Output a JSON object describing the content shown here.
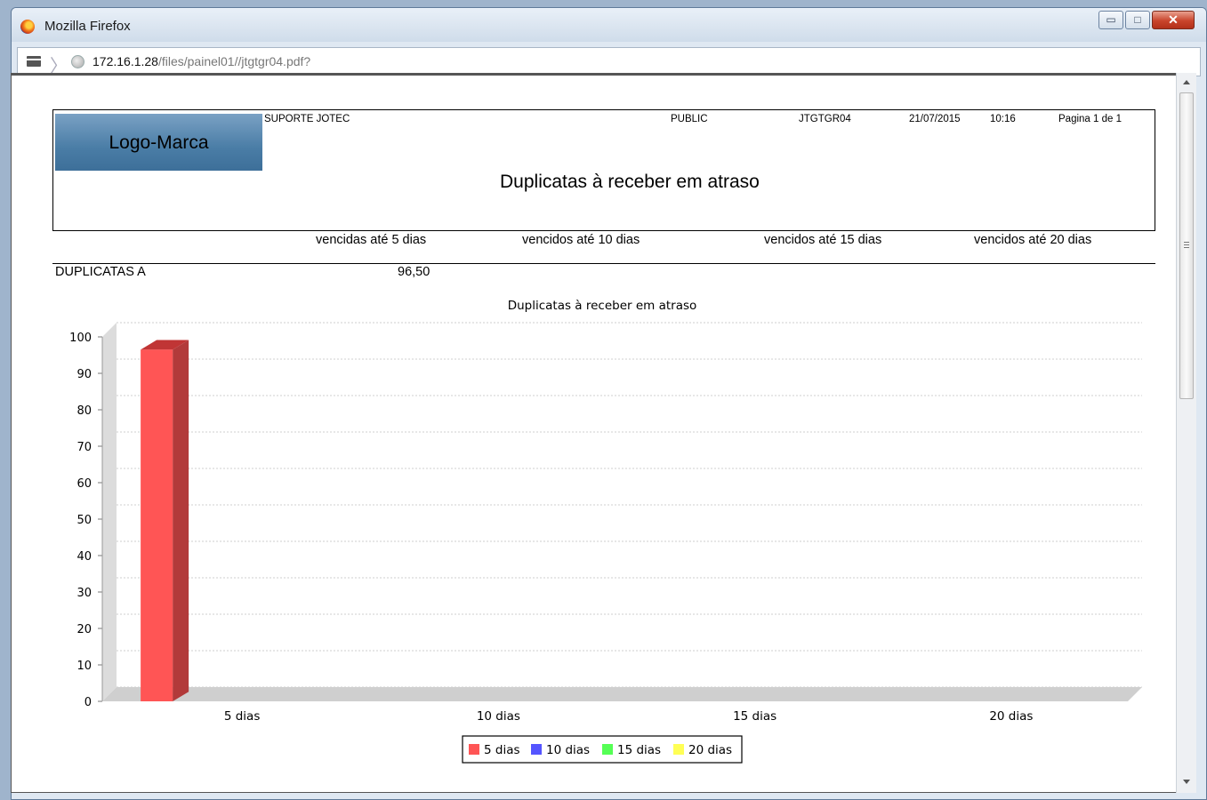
{
  "window": {
    "title": "Mozilla Firefox",
    "buttons": {
      "minimize": "▭",
      "maximize": "□",
      "close": "✕"
    },
    "minimize_icon": "minimize-icon",
    "maximize_icon": "maximize-icon",
    "close_icon": "close-icon"
  },
  "urlbar": {
    "host": "172.16.1.28",
    "path": "/files/painel01//jtgtgr04.pdf?"
  },
  "report": {
    "logo_text": "Logo-Marca",
    "company": "SUPORTE  JOTEC",
    "user": "PUBLIC",
    "program": "JTGTGR04",
    "date": "21/07/2015",
    "time": "10:16",
    "page": "Pagina 1 de   1",
    "title": "Duplicatas à receber em atraso",
    "columns": [
      "vencidas até 5 dias",
      "vencidos até 10 dias",
      "vencidos até 15 dias",
      "vencidos até 20 dias"
    ],
    "row_label": "DUPLICATAS A",
    "row_value": "96,50"
  },
  "chart_data": {
    "type": "bar",
    "title": "Duplicatas à receber em atraso",
    "categories": [
      "5 dias",
      "10 dias",
      "15 dias",
      "20 dias"
    ],
    "series": [
      {
        "name": "5 dias",
        "values": [
          96.5,
          0,
          0,
          0
        ],
        "color": "#ff5555"
      },
      {
        "name": "10 dias",
        "values": [
          0,
          0,
          0,
          0
        ],
        "color": "#5555ff"
      },
      {
        "name": "15 dias",
        "values": [
          0,
          0,
          0,
          0
        ],
        "color": "#55ff55"
      },
      {
        "name": "20 dias",
        "values": [
          0,
          0,
          0,
          0
        ],
        "color": "#ffff55"
      }
    ],
    "yticks": [
      "0",
      "10",
      "20",
      "30",
      "40",
      "50",
      "60",
      "70",
      "80",
      "90",
      "100"
    ],
    "ylim": [
      0,
      100
    ],
    "grid": true,
    "legend_position": "bottom"
  }
}
